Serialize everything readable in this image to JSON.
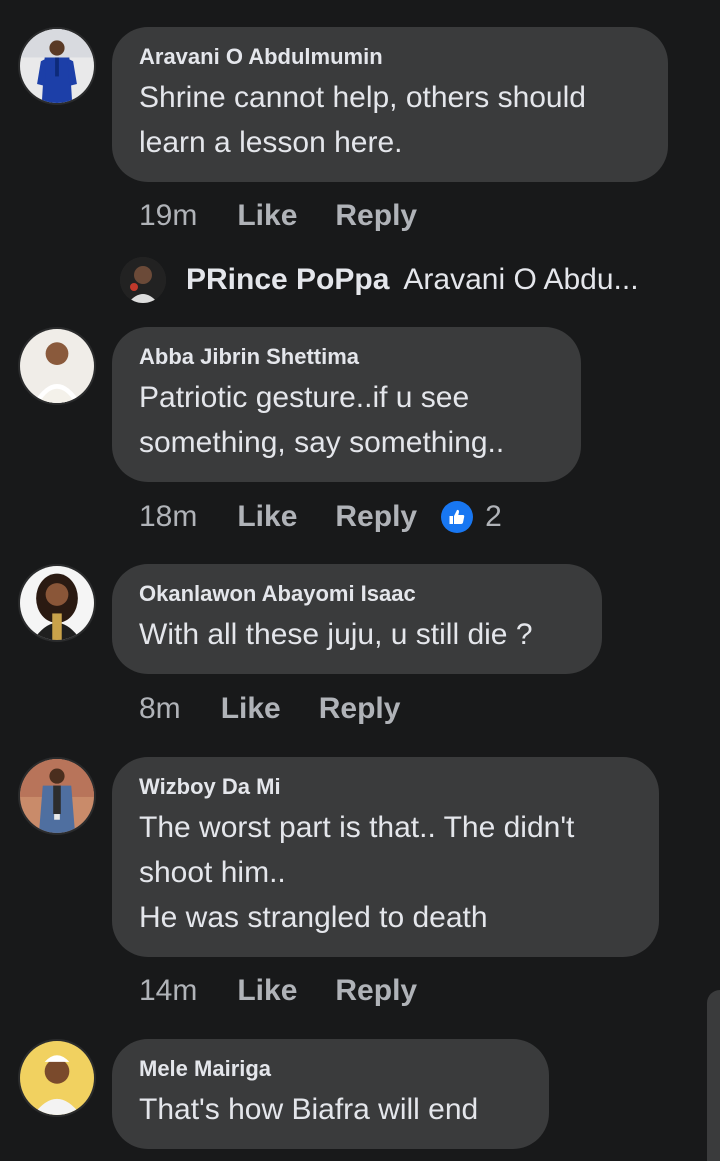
{
  "comments": [
    {
      "author": "Aravani O Abdulmumin",
      "lines": [
        "Shrine cannot help, others should",
        "learn a lesson here."
      ],
      "time": "19m",
      "like": "Like",
      "reply": "Reply",
      "avatar_icon": "person-blue-attire-avatar"
    },
    {
      "author": "Abba Jibrin Shettima",
      "lines": [
        "Patriotic gesture..if u see",
        "something, say something.."
      ],
      "time": "18m",
      "like": "Like",
      "reply": "Reply",
      "reaction_count": "2",
      "reaction_icon": "thumbs-up-icon",
      "avatar_icon": "person-white-attire-avatar"
    },
    {
      "author": "Okanlawon Abayomi Isaac",
      "lines": [
        "With all these juju, u still die ?"
      ],
      "time": "8m",
      "like": "Like",
      "reply": "Reply",
      "avatar_icon": "woman-portrait-avatar"
    },
    {
      "author": "Wizboy Da Mi",
      "lines": [
        "The worst part is that.. The didn't",
        "shoot him..",
        "He was strangled to death"
      ],
      "time": "14m",
      "like": "Like",
      "reply": "Reply",
      "avatar_icon": "man-denim-jacket-avatar"
    },
    {
      "author": "Mele Mairiga",
      "lines": [
        "That's how Biafra will end"
      ],
      "avatar_icon": "man-white-cap-avatar"
    }
  ],
  "reply_preview": {
    "author": "PRince PoPpa",
    "snippet": "Aravani O Abdu...",
    "avatar_icon": "reply-avatar"
  },
  "colors": {
    "background": "#18191a",
    "bubble": "#3a3b3c",
    "text": "#e4e6eb",
    "meta": "#b0b3b8",
    "like_blue": "#1877f2"
  }
}
